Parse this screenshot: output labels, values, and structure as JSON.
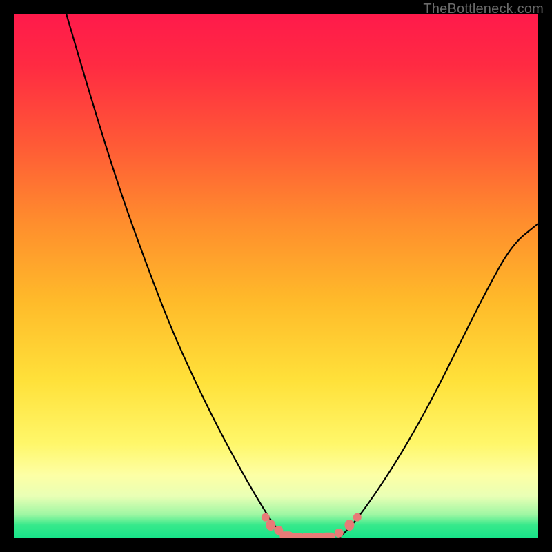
{
  "attribution": "TheBottleneck.com",
  "colors": {
    "frame": "#000000",
    "gradient_top": "#ff1a4b",
    "gradient_mid": "#ffe13a",
    "gradient_bottom": "#17e389",
    "curve": "#000000",
    "markers": "#e77b77"
  },
  "chart_data": {
    "type": "line",
    "title": "",
    "xlabel": "",
    "ylabel": "",
    "xlim": [
      0,
      100
    ],
    "ylim": [
      0,
      100
    ],
    "series": [
      {
        "name": "left-branch",
        "x": [
          10,
          15,
          20,
          25,
          30,
          35,
          40,
          45,
          48,
          50,
          52
        ],
        "values": [
          100,
          83,
          67,
          53,
          40,
          29,
          19,
          10,
          5,
          2,
          0
        ]
      },
      {
        "name": "floor",
        "x": [
          52,
          62
        ],
        "values": [
          0,
          0
        ]
      },
      {
        "name": "right-branch",
        "x": [
          62,
          65,
          70,
          75,
          80,
          85,
          90,
          95,
          100
        ],
        "values": [
          0,
          3,
          10,
          18,
          27,
          37,
          47,
          56,
          60
        ]
      }
    ],
    "markers": {
      "name": "floor-dots",
      "points": [
        {
          "x": 48,
          "y": 4
        },
        {
          "x": 49,
          "y": 2.5
        },
        {
          "x": 50.5,
          "y": 1.5
        },
        {
          "x": 52,
          "y": 0.5
        },
        {
          "x": 54,
          "y": 0.2
        },
        {
          "x": 56,
          "y": 0.2
        },
        {
          "x": 58,
          "y": 0.2
        },
        {
          "x": 60,
          "y": 0.3
        },
        {
          "x": 62,
          "y": 1
        },
        {
          "x": 64,
          "y": 2.5
        },
        {
          "x": 65.5,
          "y": 4
        }
      ]
    }
  }
}
